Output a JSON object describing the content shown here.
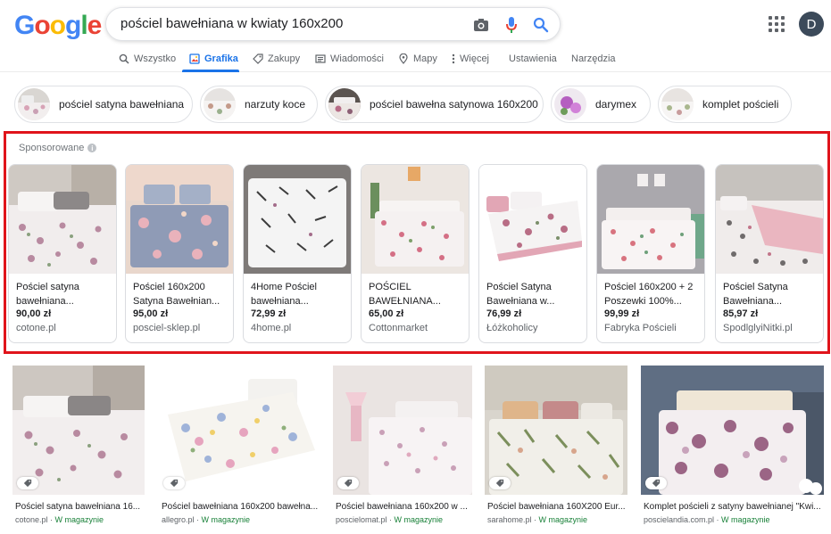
{
  "header": {
    "logo_letters": [
      {
        "ch": "G",
        "color": "#4285f4"
      },
      {
        "ch": "o",
        "color": "#ea4335"
      },
      {
        "ch": "o",
        "color": "#fbbc05"
      },
      {
        "ch": "g",
        "color": "#4285f4"
      },
      {
        "ch": "l",
        "color": "#34a853"
      },
      {
        "ch": "e",
        "color": "#ea4335"
      }
    ],
    "search_value": "pościel bawełniana w kwiaty 160x200",
    "avatar_letter": "D"
  },
  "tabs": [
    {
      "label": "Wszystko",
      "icon": "search-icon"
    },
    {
      "label": "Grafika",
      "icon": "image-icon",
      "active": true
    },
    {
      "label": "Zakupy",
      "icon": "tag-icon"
    },
    {
      "label": "Wiadomości",
      "icon": "newspaper-icon"
    },
    {
      "label": "Mapy",
      "icon": "map-pin-icon"
    },
    {
      "label": "Więcej",
      "icon": "more-vert-icon"
    },
    {
      "label": "Ustawienia"
    },
    {
      "label": "Narzędzia"
    }
  ],
  "chips": [
    {
      "label": "pościel satyna bawełniana"
    },
    {
      "label": "narzuty koce"
    },
    {
      "label": "pościel bawełna satynowa 160x200"
    },
    {
      "label": "darymex"
    },
    {
      "label": "komplet pościeli"
    }
  ],
  "sponsored": {
    "label": "Sponsorowane",
    "items": [
      {
        "title": "Pościel satyna bawełniana...",
        "price": "90,00 zł",
        "store": "cotone.pl"
      },
      {
        "title": "Pościel 160x200 Satyna Bawełnian...",
        "price": "95,00 zł",
        "store": "posciel-sklep.pl"
      },
      {
        "title": "4Home Pościel bawełniana...",
        "price": "72,99 zł",
        "store": "4home.pl"
      },
      {
        "title": "POŚCIEL BAWEŁNIANA...",
        "price": "65,00 zł",
        "store": "Cottonmarket"
      },
      {
        "title": "Pościel Satyna Bawełniana w...",
        "price": "76,99 zł",
        "store": "Łóżkoholicy"
      },
      {
        "title": "Pościel 160x200 + 2 Poszewki 100%...",
        "price": "99,99 zł",
        "store": "Fabryka Pościeli"
      },
      {
        "title": "Pościel Satyna Bawełniana...",
        "price": "85,97 zł",
        "store": "SpodlglyiNitki.pl"
      }
    ]
  },
  "results": [
    {
      "title": "Pościel satyna bawełniana 16...",
      "source": "cotone.pl",
      "stock": "W magazynie"
    },
    {
      "title": "Pościel bawełniana 160x200 bawełna...",
      "source": "allegro.pl",
      "stock": "W magazynie"
    },
    {
      "title": "Pościel bawełniana 160x200 w ...",
      "source": "poscielomat.pl",
      "stock": "W magazynie"
    },
    {
      "title": "Pościel bawełniana 160X200 Eur...",
      "source": "sarahome.pl",
      "stock": "W magazynie"
    },
    {
      "title": "Komplet pościeli z satyny bawełnianej \"Kwi...",
      "source": "poscielandia.com.pl",
      "stock": "W magazynie"
    }
  ],
  "separator": " · "
}
